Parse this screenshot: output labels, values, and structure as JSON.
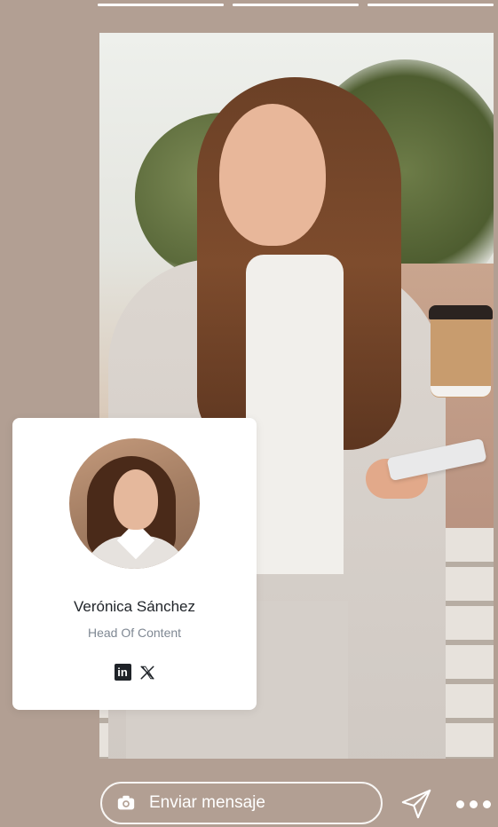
{
  "story": {
    "progress": [
      1,
      1,
      1
    ],
    "image_alt": "Woman in light suit with coffee cup and phone on stairs"
  },
  "profile": {
    "name": "Verónica Sánchez",
    "role": "Head Of Content",
    "social": [
      "linkedin-icon",
      "x-icon"
    ]
  },
  "message_bar": {
    "placeholder": "Enviar mensaje",
    "icon": "camera-icon"
  },
  "actions": {
    "send_icon": "send-icon",
    "more_icon": "more-icon"
  },
  "colors": {
    "background": "#b29f93",
    "card": "#ffffff",
    "name": "#1f2328",
    "role": "#7f8893"
  }
}
